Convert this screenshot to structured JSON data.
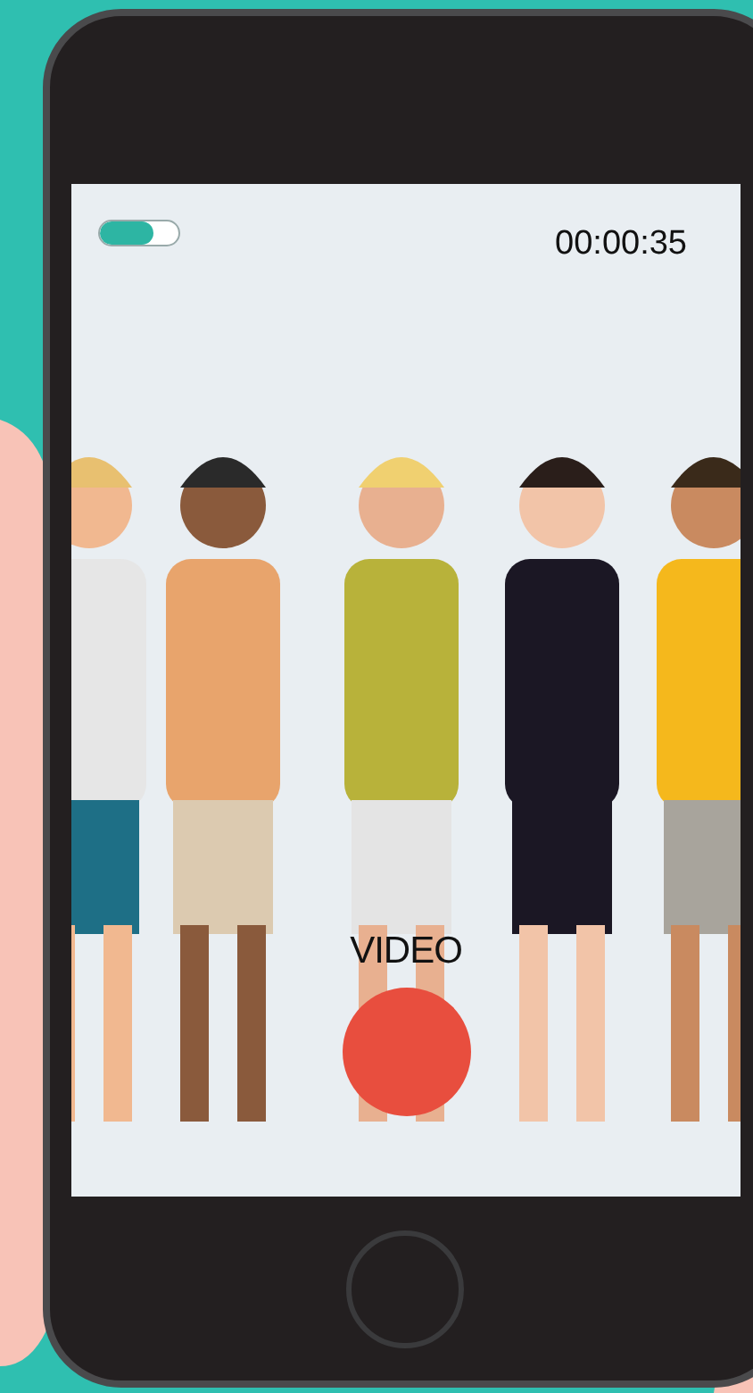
{
  "camera": {
    "switch": {
      "on": true
    },
    "timer": "00:00:35",
    "mode_label": "VIDEO",
    "record_button": {
      "recording": false
    }
  }
}
